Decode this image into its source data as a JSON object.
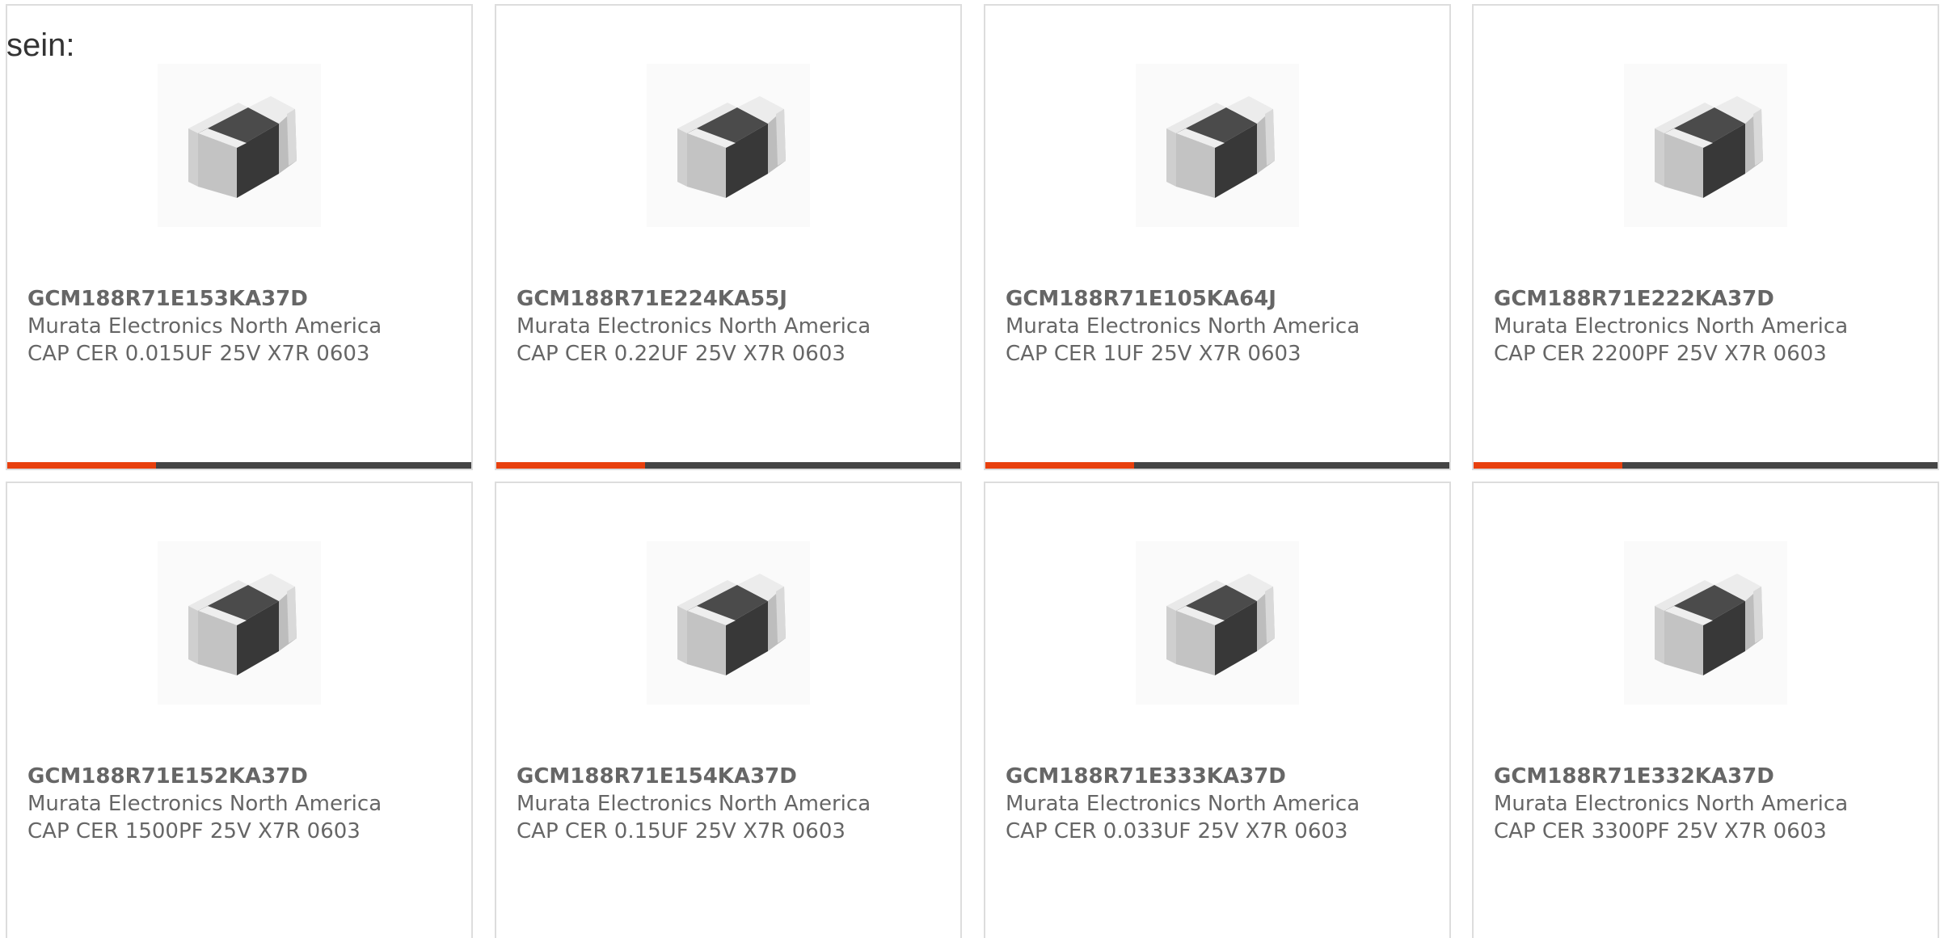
{
  "intro_label": "sein:",
  "colors": {
    "accent": "#e8400e",
    "bar": "#444444",
    "border": "#dddddd",
    "text": "#666666"
  },
  "products": [
    {
      "part_number": "GCM188R71E153KA37D",
      "manufacturer": "Murata Electronics North America",
      "description": "CAP CER 0.015UF 25V X7R 0603",
      "image_icon": "ceramic-capacitor-chip-icon"
    },
    {
      "part_number": "GCM188R71E224KA55J",
      "manufacturer": "Murata Electronics North America",
      "description": "CAP CER 0.22UF 25V X7R 0603",
      "image_icon": "ceramic-capacitor-chip-icon"
    },
    {
      "part_number": "GCM188R71E105KA64J",
      "manufacturer": "Murata Electronics North America",
      "description": "CAP CER 1UF 25V X7R 0603",
      "image_icon": "ceramic-capacitor-chip-icon"
    },
    {
      "part_number": "GCM188R71E222KA37D",
      "manufacturer": "Murata Electronics North America",
      "description": "CAP CER 2200PF 25V X7R 0603",
      "image_icon": "ceramic-capacitor-chip-icon"
    },
    {
      "part_number": "GCM188R71E152KA37D",
      "manufacturer": "Murata Electronics North America",
      "description": "CAP CER 1500PF 25V X7R 0603",
      "image_icon": "ceramic-capacitor-chip-icon"
    },
    {
      "part_number": "GCM188R71E154KA37D",
      "manufacturer": "Murata Electronics North America",
      "description": "CAP CER 0.15UF 25V X7R 0603",
      "image_icon": "ceramic-capacitor-chip-icon"
    },
    {
      "part_number": "GCM188R71E333KA37D",
      "manufacturer": "Murata Electronics North America",
      "description": "CAP CER 0.033UF 25V X7R 0603",
      "image_icon": "ceramic-capacitor-chip-icon"
    },
    {
      "part_number": "GCM188R71E332KA37D",
      "manufacturer": "Murata Electronics North America",
      "description": "CAP CER 3300PF 25V X7R 0603",
      "image_icon": "ceramic-capacitor-chip-icon"
    }
  ]
}
